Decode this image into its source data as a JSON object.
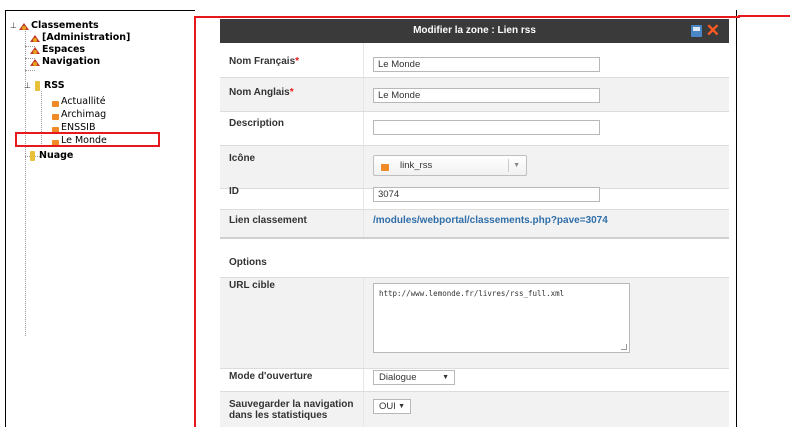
{
  "tree": {
    "root": "Classements",
    "items": [
      {
        "label": "[Administration]",
        "bold": true
      },
      {
        "label": "Espaces",
        "bold": true
      },
      {
        "label": "Navigation",
        "bold": true
      },
      {
        "label": "RSS",
        "bold": true
      },
      {
        "label": "Actuallité",
        "bold": false
      },
      {
        "label": "Archimag",
        "bold": false
      },
      {
        "label": "ENSSIB",
        "bold": false
      },
      {
        "label": "Le Monde",
        "bold": false
      },
      {
        "label": "Nuage",
        "bold": true
      }
    ]
  },
  "dialog": {
    "title": "Modifier la zone : Lien rss",
    "fields": {
      "nom_fr": {
        "label": "Nom Français",
        "required_mark": "*",
        "value": "Le Monde"
      },
      "nom_en": {
        "label": "Nom Anglais",
        "required_mark": "*",
        "value": "Le Monde"
      },
      "description": {
        "label": "Description",
        "value": ""
      },
      "icone": {
        "label": "Icône",
        "value": "link_rss"
      },
      "id": {
        "label": "ID",
        "value": "3074"
      },
      "lien": {
        "label": "Lien classement",
        "value": "/modules/webportal/classements.php?pave=3074"
      }
    },
    "options": {
      "heading": "Options",
      "url": {
        "label": "URL cible",
        "value": "http://www.lemonde.fr/livres/rss_full.xml"
      },
      "mode": {
        "label": "Mode d'ouverture",
        "value": "Dialogue"
      },
      "stats": {
        "label_line1": "Sauvegarder la navigation",
        "label_line2": "dans les statistiques",
        "value": "OUI"
      }
    }
  },
  "colors": {
    "header_bg": "#3a3a3a",
    "highlight_red": "#e8191d",
    "link_blue": "#2f6ea8",
    "close_orange": "#ff5a1f"
  }
}
